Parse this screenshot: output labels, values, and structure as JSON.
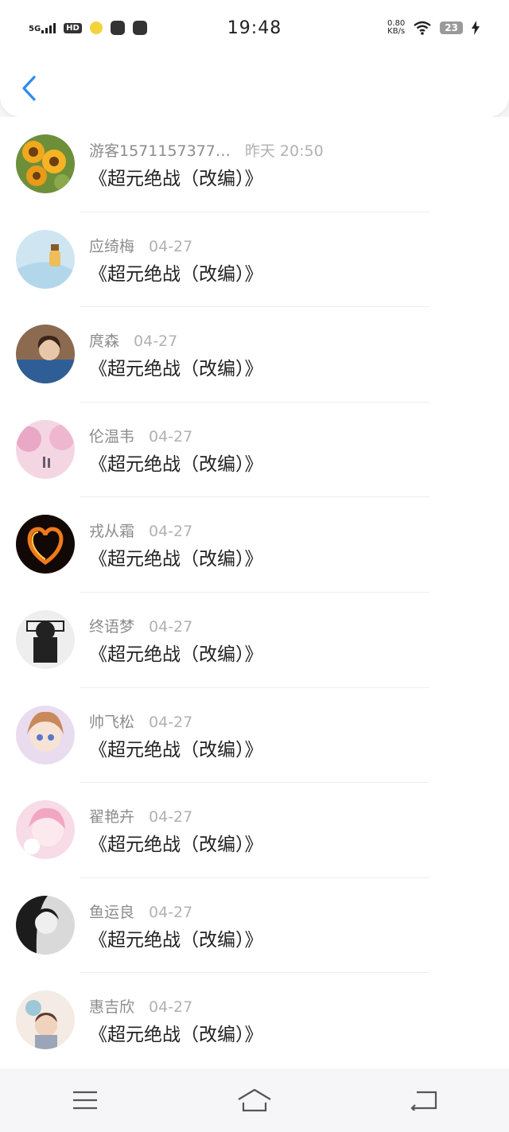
{
  "status_bar": {
    "network": "5G",
    "hd_badge": "HD",
    "time": "19:48",
    "speed_value": "0.80",
    "speed_unit": "KB/s",
    "battery": "23"
  },
  "header": {
    "back_icon": "chevron-left-icon"
  },
  "list": [
    {
      "name": "游客1571157377…",
      "time": "昨天 20:50",
      "title": "《超元绝战（改编）》",
      "avatar": "sunflower"
    },
    {
      "name": "应绮梅",
      "time": "04-27",
      "title": "《超元绝战（改编）》",
      "avatar": "bottle"
    },
    {
      "name": "庹森",
      "time": "04-27",
      "title": "《超元绝战（改编）》",
      "avatar": "girl-photo"
    },
    {
      "name": "伦温韦",
      "time": "04-27",
      "title": "《超元绝战（改编）》",
      "avatar": "sakura"
    },
    {
      "name": "戎从霜",
      "time": "04-27",
      "title": "《超元绝战（改编）》",
      "avatar": "fire-heart"
    },
    {
      "name": "终语梦",
      "time": "04-27",
      "title": "《超元绝战（改编）》",
      "avatar": "game-sketch"
    },
    {
      "name": "帅飞松",
      "time": "04-27",
      "title": "《超元绝战（改编）》",
      "avatar": "anime-girl"
    },
    {
      "name": "翟艳卉",
      "time": "04-27",
      "title": "《超元绝战（改编）》",
      "avatar": "pink-anime"
    },
    {
      "name": "鱼运良",
      "time": "04-27",
      "title": "《超元绝战（改编）》",
      "avatar": "bw-portrait"
    },
    {
      "name": "惠吉欣",
      "time": "04-27",
      "title": "《超元绝战（改编）》",
      "avatar": "child-photo"
    }
  ],
  "nav_bar": {
    "menu_icon": "menu-icon",
    "home_icon": "home-icon",
    "back_icon": "back-icon"
  }
}
